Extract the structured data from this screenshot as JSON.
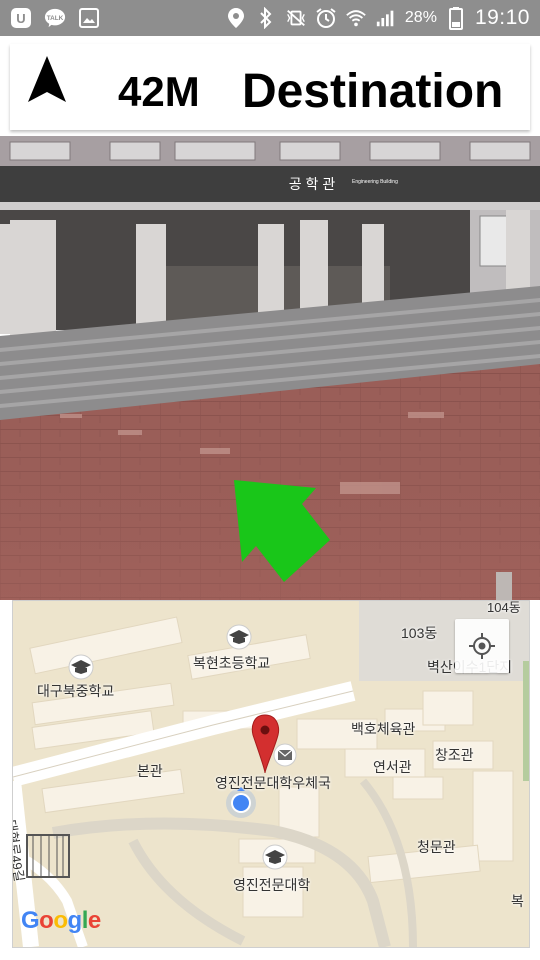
{
  "status_bar": {
    "left_icons": [
      "u-plus-icon",
      "kakaotalk-icon",
      "gallery-icon"
    ],
    "talk_label": "TALK",
    "right_icons": [
      "location-icon",
      "bluetooth-icon",
      "vibrate-off-icon",
      "alarm-icon",
      "wifi-icon",
      "signal-icon",
      "battery-icon"
    ],
    "battery": "28%",
    "time": "19:10"
  },
  "nav": {
    "distance": "42M",
    "destination": "Destination"
  },
  "camera": {
    "building_sign": "공 학 관",
    "building_sign_en": "Engineering Building",
    "arrow_color": "#19c619"
  },
  "map": {
    "labels": {
      "dong103": "103동",
      "dong104": "104동",
      "bukhyun": "복현초등학교",
      "daegu": "대구북중학교",
      "baekho": "백호체육관",
      "changjo": "창조관",
      "bongwan": "본관",
      "yeonseo": "연서관",
      "post": "영진전문대학우체국",
      "cheongmun": "청문관",
      "yeongjin": "영진전문대학",
      "bukshin": "벽산이수1단지",
      "road": "대현로49길",
      "buk": "복"
    },
    "google": [
      "G",
      "o",
      "o",
      "g",
      "l",
      "e"
    ],
    "google_colors": [
      "#4285F4",
      "#EA4335",
      "#FBBC05",
      "#4285F4",
      "#34A853",
      "#EA4335"
    ],
    "pin_color": "#d32f2f",
    "dot_color": "#4285F4"
  }
}
